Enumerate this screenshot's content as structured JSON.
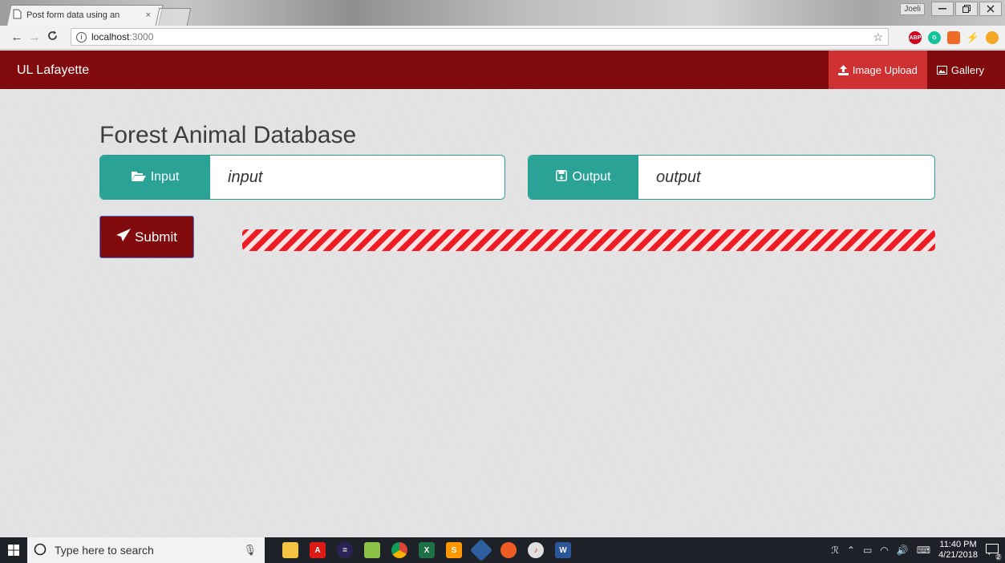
{
  "browser": {
    "tab_title": "Post form data using an",
    "tab_close": "×",
    "profile": "Joeli",
    "url_host": "localhost",
    "url_port": ":3000"
  },
  "navbar": {
    "brand": "UL Lafayette",
    "links": [
      {
        "label": "Image Upload",
        "icon": "upload-icon",
        "active": true
      },
      {
        "label": "Gallery",
        "icon": "picture-icon",
        "active": false
      }
    ]
  },
  "main": {
    "title": "Forest Animal Database",
    "input_group": {
      "label": "Input",
      "icon": "folder-open-icon",
      "placeholder": "input"
    },
    "output_group": {
      "label": "Output",
      "icon": "floppy-save-icon",
      "placeholder": "output"
    },
    "submit_label": "Submit",
    "progress": {
      "percent": 100,
      "style": "striped",
      "color": "#ee1c24"
    }
  },
  "colors": {
    "navbar_bg": "#800a0c",
    "active_link_bg": "#cf3132",
    "input_addon_bg": "#2aa396",
    "submit_bg": "#800a0c"
  },
  "taskbar": {
    "search_placeholder": "Type here to search",
    "time": "11:40 PM",
    "date": "4/21/2018",
    "notification_count": "2"
  }
}
